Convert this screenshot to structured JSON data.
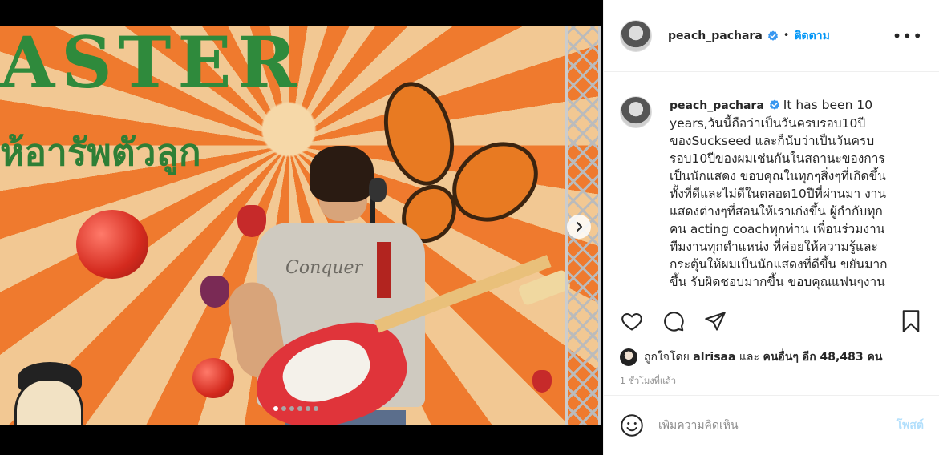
{
  "post": {
    "username": "peach_pachara",
    "follow_label": "ติดตาม",
    "more_label": "•••",
    "separator": "•",
    "caption": "It has been 10 years,วันนี้ถือว่าเป็นวันครบรอบ10ปีของSuckseed และก็นับว่าเป็นวันครบรอบ10ปีของผมเช่นกันในสถานะของการเป็นนักแสดง ขอบคุณในทุกๆสิ่งๆที่เกิดขึ้นทั้งที่ดีและไม่ดีในตลอด10ปีที่ผ่านมา งานแสดงต่างๆที่สอนให้เราเก่งขึ้น ผู้กำกับทุกคน acting coachทุกท่าน เพื่อนร่วมงาน ทีมงานทุกตำแหน่ง ที่ค่อยให้ความรู้และกระตุ้นให้ผมเป็นนักแสดงที่ดีขึ้น ขยันมากขึ้น รับผิดชอบมากขึ้น ขอบคุณแฟนๆงาน",
    "likes": {
      "prefix": "ถูกใจโดย",
      "liker": "alrisaa",
      "conjunction": "และ",
      "others": "คนอื่นๆ อีก 48,483 คน"
    },
    "time_ago": "1 ชั่วโมงที่แล้ว",
    "comment_placeholder": "เพิ่มความคิดเห็น",
    "post_button": "โพสต์"
  },
  "media": {
    "banner_text": "ASTER",
    "banner_thai": "ห้อารัพตัวลูก",
    "shirt_print": "Conquer",
    "carousel_count": 6,
    "carousel_active": 0
  },
  "colors": {
    "link_blue": "#0095f6",
    "post_disabled": "#b2dffc",
    "verified_blue": "#3897f0"
  },
  "icons": [
    "verified-badge-icon",
    "more-options-icon",
    "heart-icon",
    "comment-icon",
    "share-icon",
    "bookmark-icon",
    "emoji-icon",
    "chevron-right-icon"
  ]
}
